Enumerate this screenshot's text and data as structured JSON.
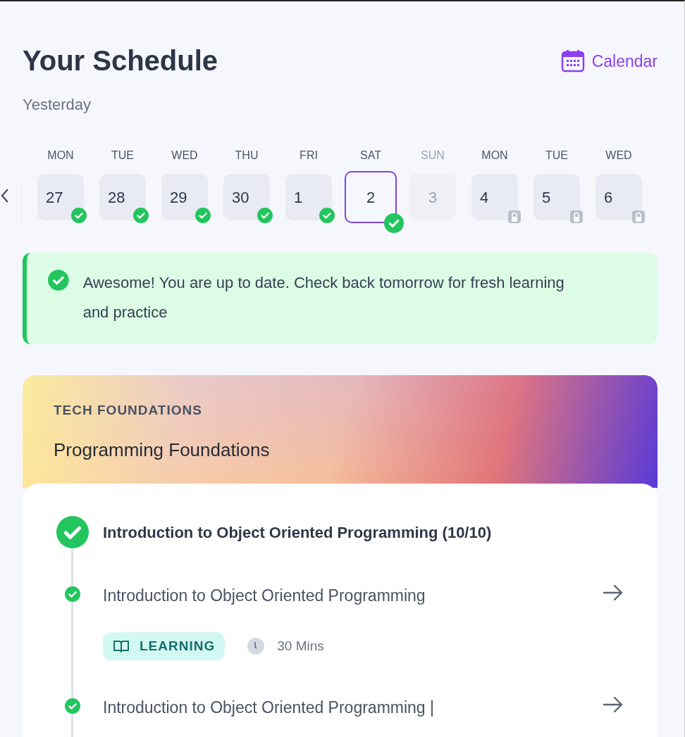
{
  "header": {
    "title": "Your Schedule",
    "subtitle": "Yesterday",
    "calendar_link": "Calendar"
  },
  "days": [
    {
      "weekday": "MON",
      "date": "27",
      "kind": "done",
      "selected": false
    },
    {
      "weekday": "TUE",
      "date": "28",
      "kind": "done",
      "selected": false
    },
    {
      "weekday": "WED",
      "date": "29",
      "kind": "done",
      "selected": false
    },
    {
      "weekday": "THU",
      "date": "30",
      "kind": "done",
      "selected": false
    },
    {
      "weekday": "FRI",
      "date": "1",
      "kind": "done",
      "selected": false
    },
    {
      "weekday": "SAT",
      "date": "2",
      "kind": "done",
      "selected": true
    },
    {
      "weekday": "SUN",
      "date": "3",
      "kind": "off",
      "selected": false
    },
    {
      "weekday": "MON",
      "date": "4",
      "kind": "locked",
      "selected": false
    },
    {
      "weekday": "TUE",
      "date": "5",
      "kind": "locked",
      "selected": false
    },
    {
      "weekday": "WED",
      "date": "6",
      "kind": "locked",
      "selected": false
    }
  ],
  "alert": {
    "message": "Awesome! You are up to date. Check back tomorrow for fresh learning and practice"
  },
  "course": {
    "category": "TECH FOUNDATIONS",
    "title": "Programming Foundations",
    "module": {
      "title": "Introduction to Object Oriented Programming (10/10)",
      "done": true
    },
    "items": [
      {
        "title": "Introduction to Object Oriented Programming",
        "done": true,
        "tag": "LEARNING",
        "duration": "30 Mins"
      },
      {
        "title": "Introduction to Object Oriented Programming |",
        "done": true
      }
    ]
  }
}
